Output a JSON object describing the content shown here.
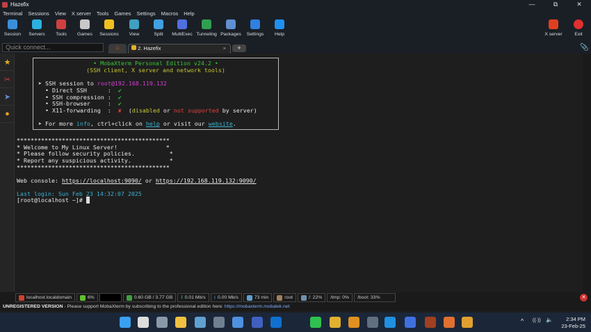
{
  "window": {
    "title": "Hazefix",
    "minimize": "—",
    "maximize": "⧉",
    "close": "✕"
  },
  "menu": [
    "Terminal",
    "Sessions",
    "View",
    "X server",
    "Tools",
    "Games",
    "Settings",
    "Macros",
    "Help"
  ],
  "toolbar": [
    {
      "label": "Session",
      "color": "#3b8fd8"
    },
    {
      "label": "Servers",
      "color": "#2bb0e0"
    },
    {
      "label": "Tools",
      "color": "#d04040"
    },
    {
      "label": "Games",
      "color": "#c8c8c8"
    },
    {
      "label": "Sessions",
      "color": "#f0c020"
    },
    {
      "label": "View",
      "color": "#40a0c0"
    },
    {
      "label": "Split",
      "color": "#40a0e0"
    },
    {
      "label": "MultiExec",
      "color": "#5070e0"
    },
    {
      "label": "Tunneling",
      "color": "#30a050"
    },
    {
      "label": "Packages",
      "color": "#6090d0"
    },
    {
      "label": "Settings",
      "color": "#3080e0"
    },
    {
      "label": "Help",
      "color": "#2090f0"
    }
  ],
  "toolbar_right": [
    {
      "label": "X server",
      "color": "#e04020"
    },
    {
      "label": "Exit",
      "color": "#e03030"
    }
  ],
  "tabs": {
    "quick_connect_placeholder": "Quick connect...",
    "home": "⌂",
    "session_tab": "2. Hazefix",
    "close": "×",
    "new_tab": "+"
  },
  "sidebar": [
    {
      "icon": "star-icon",
      "glyph": "★",
      "color": "#e0b020"
    },
    {
      "icon": "tools-icon",
      "glyph": "✂",
      "color": "#d04040"
    },
    {
      "icon": "send-icon",
      "glyph": "➤",
      "color": "#6090d0"
    },
    {
      "icon": "macro-icon",
      "glyph": "●",
      "color": "#e0a020"
    }
  ],
  "banner": {
    "title": "• MobaXterm Personal Edition v24.2 •",
    "subtitle": "(SSH client, X server and network tools)",
    "session_prefix": "➤ SSH session to ",
    "session_target": "root@192.168.119.132",
    "features": [
      {
        "name": "  • Direct SSH      :  ",
        "status": "✔",
        "ok": true
      },
      {
        "name": "  • SSH compression :  ",
        "status": "✔",
        "ok": true
      },
      {
        "name": "  • SSH-browser     :  ",
        "status": "✔",
        "ok": true
      },
      {
        "name": "  • X11-forwarding  :  ",
        "status": "✘",
        "ok": false
      }
    ],
    "x11_note": {
      "open": "  (",
      "disabled": "disabled",
      "or": " or ",
      "not_supported": "not supported",
      "tail": " by server)"
    },
    "more": {
      "a": "➤ For more ",
      "info": "info",
      "b": ", ctrl+click on ",
      "help": "help",
      "c": " or visit our ",
      "website": "website",
      "d": "."
    }
  },
  "motd": [
    "********************************************",
    "* Welcome to My Linux Server!              *",
    "* Please follow security policies.          *",
    "* Report any suspicious activity.           *",
    "********************************************"
  ],
  "web_console": {
    "label": "Web console: ",
    "url1": "https://localhost:9090/",
    "or": " or ",
    "url2": "https://192.168.119.132:9090/"
  },
  "last_login": "Last login: Sun Feb 23 14:32:07 2025",
  "prompt": "[root@localhost ~]# ",
  "status": {
    "host": "localhost.localdomain",
    "cpu": "6%",
    "mem": "0.60 GB / 3.77 GB",
    "up": "0.01 Mb/s",
    "down": "0.00 Mb/s",
    "uptime": "73 min",
    "user": "root",
    "disk_root": "/: 22%",
    "disk_tmp": "/tmp: 0%",
    "disk_boot": "/boot: 33%"
  },
  "unregistered": {
    "label": "UNREGISTERED VERSION",
    "text": "  -  Please support MobaXterm by subscribing to the professional edition here:  ",
    "url": "https://mobaxterm.mobatek.net"
  },
  "taskbar": {
    "apps": [
      {
        "name": "start",
        "color": "#3aa0f0"
      },
      {
        "name": "search",
        "color": "#dddddd"
      },
      {
        "name": "settings",
        "color": "#8899aa"
      },
      {
        "name": "file-explorer",
        "color": "#f0c040"
      },
      {
        "name": "photos",
        "color": "#60a0d0"
      },
      {
        "name": "calculator",
        "color": "#708090"
      },
      {
        "name": "notepad",
        "color": "#5090e0"
      },
      {
        "name": "app",
        "color": "#4060c0"
      },
      {
        "name": "outlook",
        "color": "#1070d0"
      },
      {
        "name": "whatsapp",
        "color": "#30c050"
      },
      {
        "name": "chrome",
        "color": "#e0b030"
      },
      {
        "name": "vmware",
        "color": "#e09020"
      },
      {
        "name": "mobaxterm",
        "color": "#607080"
      },
      {
        "name": "vscode",
        "color": "#2090e0"
      },
      {
        "name": "zoom",
        "color": "#4070e0"
      },
      {
        "name": "game",
        "color": "#a04020"
      },
      {
        "name": "xampp",
        "color": "#e07030"
      },
      {
        "name": "app2",
        "color": "#e0a030"
      }
    ],
    "tray": {
      "chevron": "^",
      "wifi": "((·))",
      "volume": "🔈"
    },
    "time": "2:34 PM",
    "date": "23-Feb-25"
  }
}
